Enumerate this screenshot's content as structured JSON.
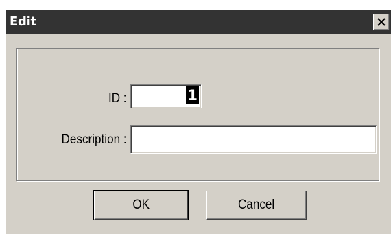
{
  "window": {
    "title": "Edit",
    "close_icon": "close-icon"
  },
  "form": {
    "id_label": "ID :",
    "id_value": "1",
    "description_label": "Description :",
    "description_value": ""
  },
  "buttons": {
    "ok_label": "OK",
    "cancel_label": "Cancel"
  }
}
